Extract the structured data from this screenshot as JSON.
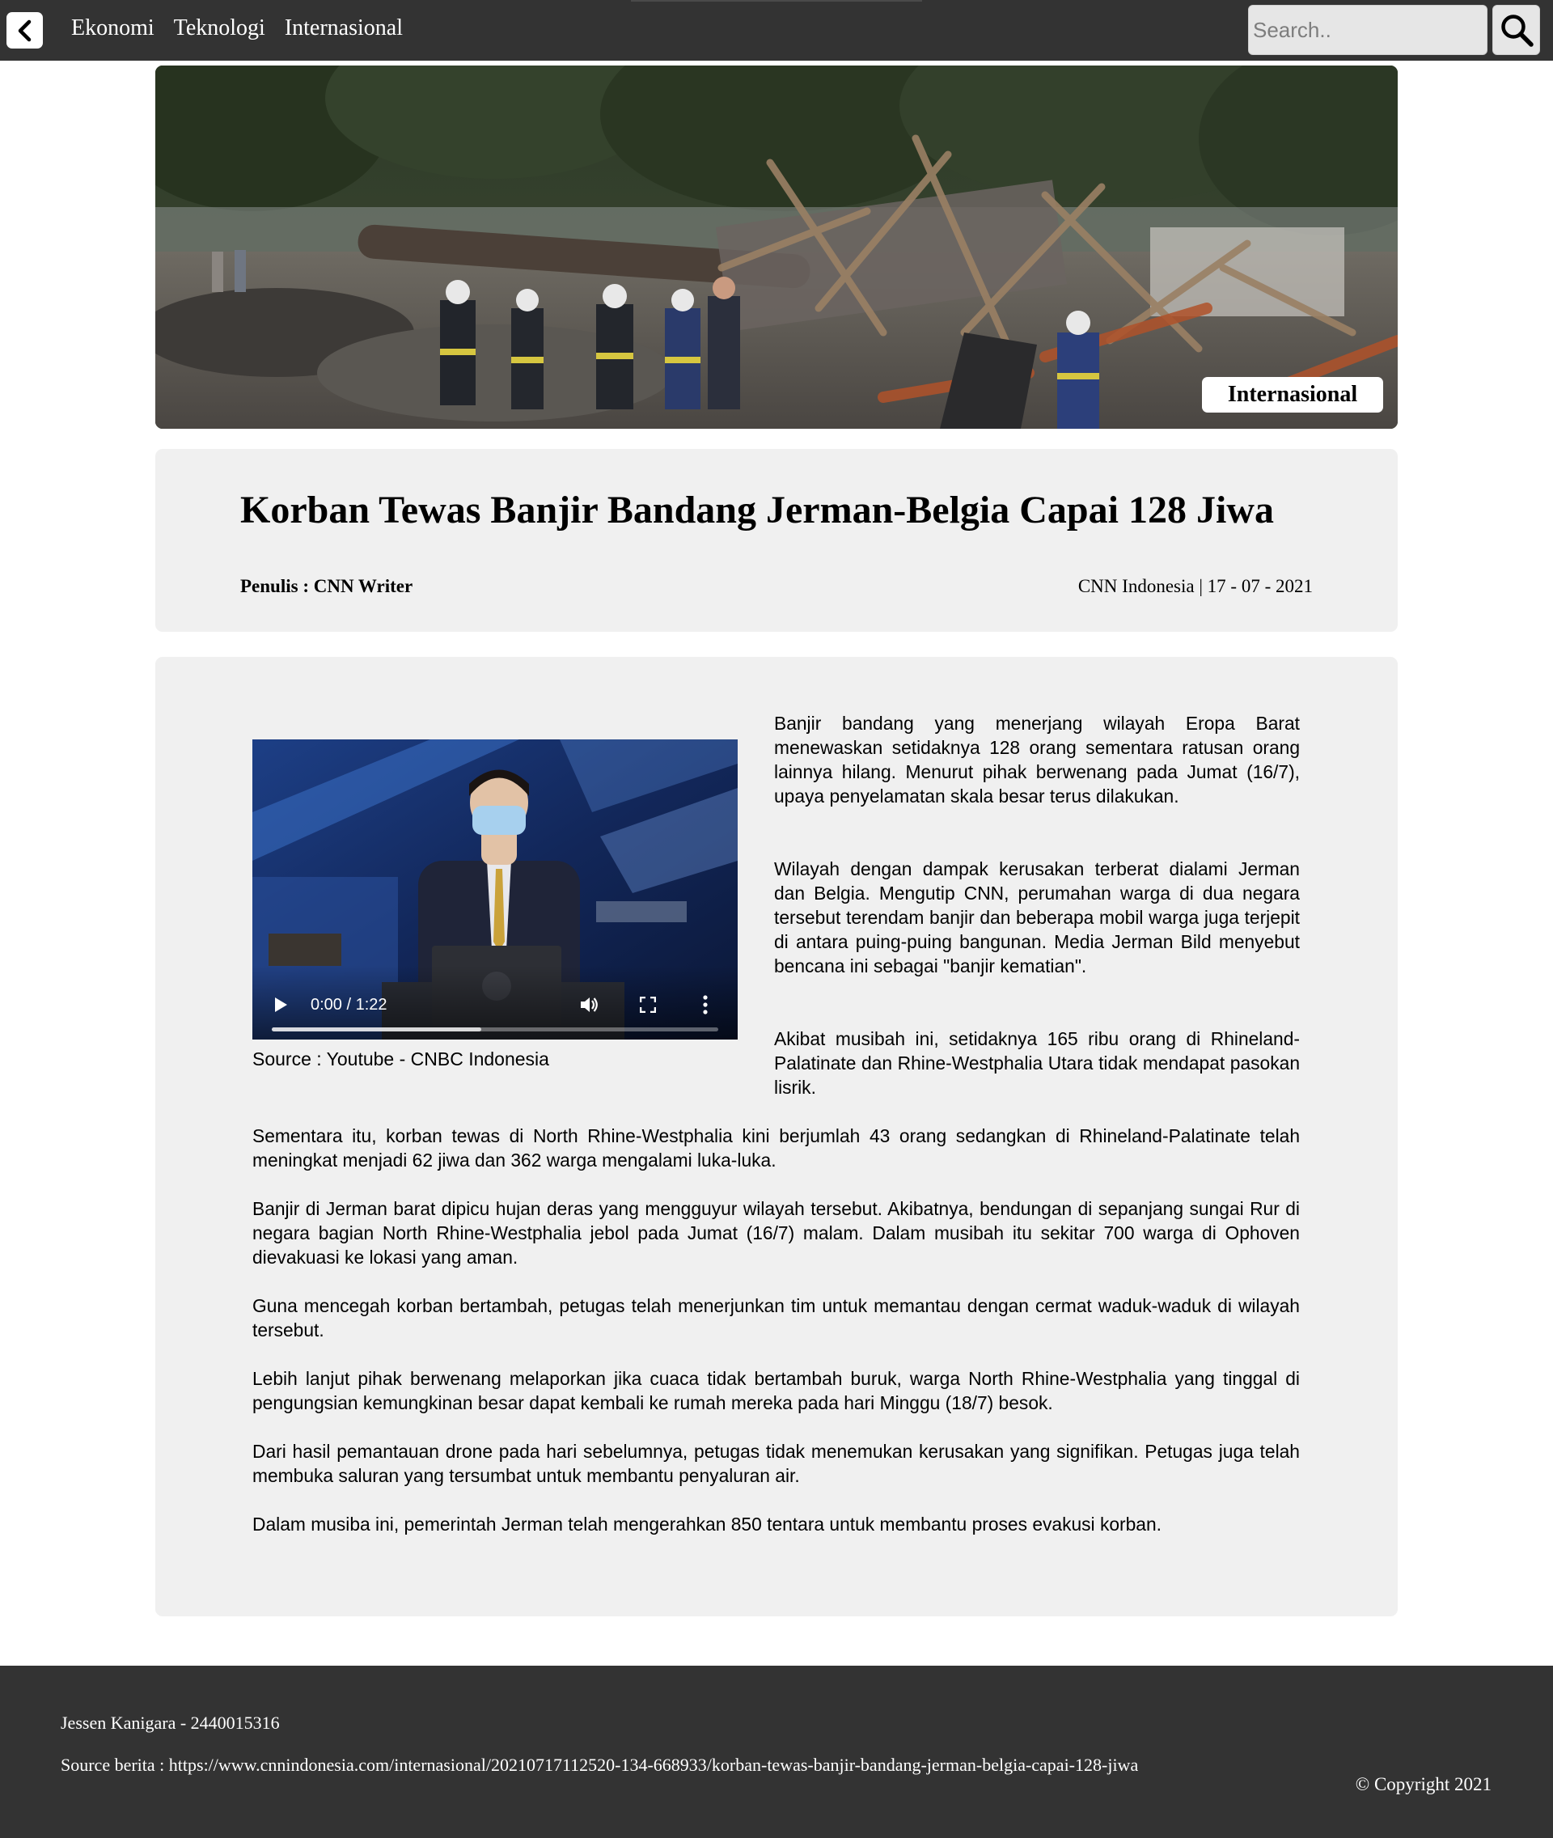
{
  "nav": {
    "back_icon": "chevron-left-icon",
    "links": [
      "Ekonomi",
      "Teknologi",
      "Internasional"
    ],
    "search_placeholder": "Search..",
    "search_icon": "search-icon"
  },
  "hero": {
    "category_badge": "Internasional"
  },
  "article": {
    "title": "Korban Tewas Banjir Bandang Jerman-Belgia Capai 128 Jiwa",
    "author": "Penulis : CNN Writer",
    "source_date": "CNN Indonesia | 17 - 07 - 2021",
    "video": {
      "time": "0:00 / 1:22",
      "progress": 0.47,
      "caption": "Source : Youtube - CNBC Indonesia",
      "play_icon": "play-icon",
      "volume_icon": "volume-icon",
      "fullscreen_icon": "fullscreen-icon",
      "more_icon": "more-vertical-icon"
    },
    "paragraphs": [
      "Banjir bandang yang menerjang wilayah Eropa Barat menewaskan setidaknya 128 orang sementara ratusan orang lainnya hilang. Menurut pihak berwenang pada Jumat (16/7), upaya penyelamatan skala besar terus dilakukan.",
      "Wilayah dengan dampak kerusakan terberat dialami Jerman dan Belgia. Mengutip CNN, perumahan warga di dua negara tersebut terendam banjir dan beberapa mobil warga juga terjepit di antara puing-puing bangunan. Media Jerman Bild menyebut bencana ini sebagai \"banjir kematian\".",
      "Akibat musibah ini, setidaknya 165 ribu orang di Rhineland-Palatinate dan Rhine-Westphalia Utara tidak mendapat pasokan lisrik.",
      "Sementara itu, korban tewas di North Rhine-Westphalia kini berjumlah 43 orang sedangkan di Rhineland-Palatinate telah meningkat menjadi 62 jiwa dan 362 warga mengalami luka-luka.",
      "Banjir di Jerman barat dipicu hujan deras yang mengguyur wilayah tersebut. Akibatnya, bendungan di sepanjang sungai Rur di negara bagian North Rhine-Westphalia jebol pada Jumat (16/7) malam. Dalam musibah itu sekitar 700 warga di Ophoven dievakuasi ke lokasi yang aman.",
      "Guna mencegah korban bertambah, petugas telah menerjunkan tim untuk memantau dengan cermat waduk-waduk di wilayah tersebut.",
      "Lebih lanjut pihak berwenang melaporkan jika cuaca tidak bertambah buruk, warga North Rhine-Westphalia yang tinggal di pengungsian kemungkinan besar dapat kembali ke rumah mereka pada hari Minggu (18/7) besok.",
      "Dari hasil pemantauan drone pada hari sebelumnya, petugas tidak menemukan kerusakan yang signifikan. Petugas juga telah membuka saluran yang tersumbat untuk membantu penyaluran air.",
      "Dalam musiba ini, pemerintah Jerman telah mengerahkan 850 tentara untuk membantu proses evakusi korban."
    ]
  },
  "footer": {
    "author": "Jessen Kanigara - 2440015316",
    "source": "Source berita : https://www.cnnindonesia.com/internasional/20210717112520-134-668933/korban-tewas-banjir-bandang-jerman-belgia-capai-128-jiwa",
    "copyright": "© Copyright 2021"
  }
}
